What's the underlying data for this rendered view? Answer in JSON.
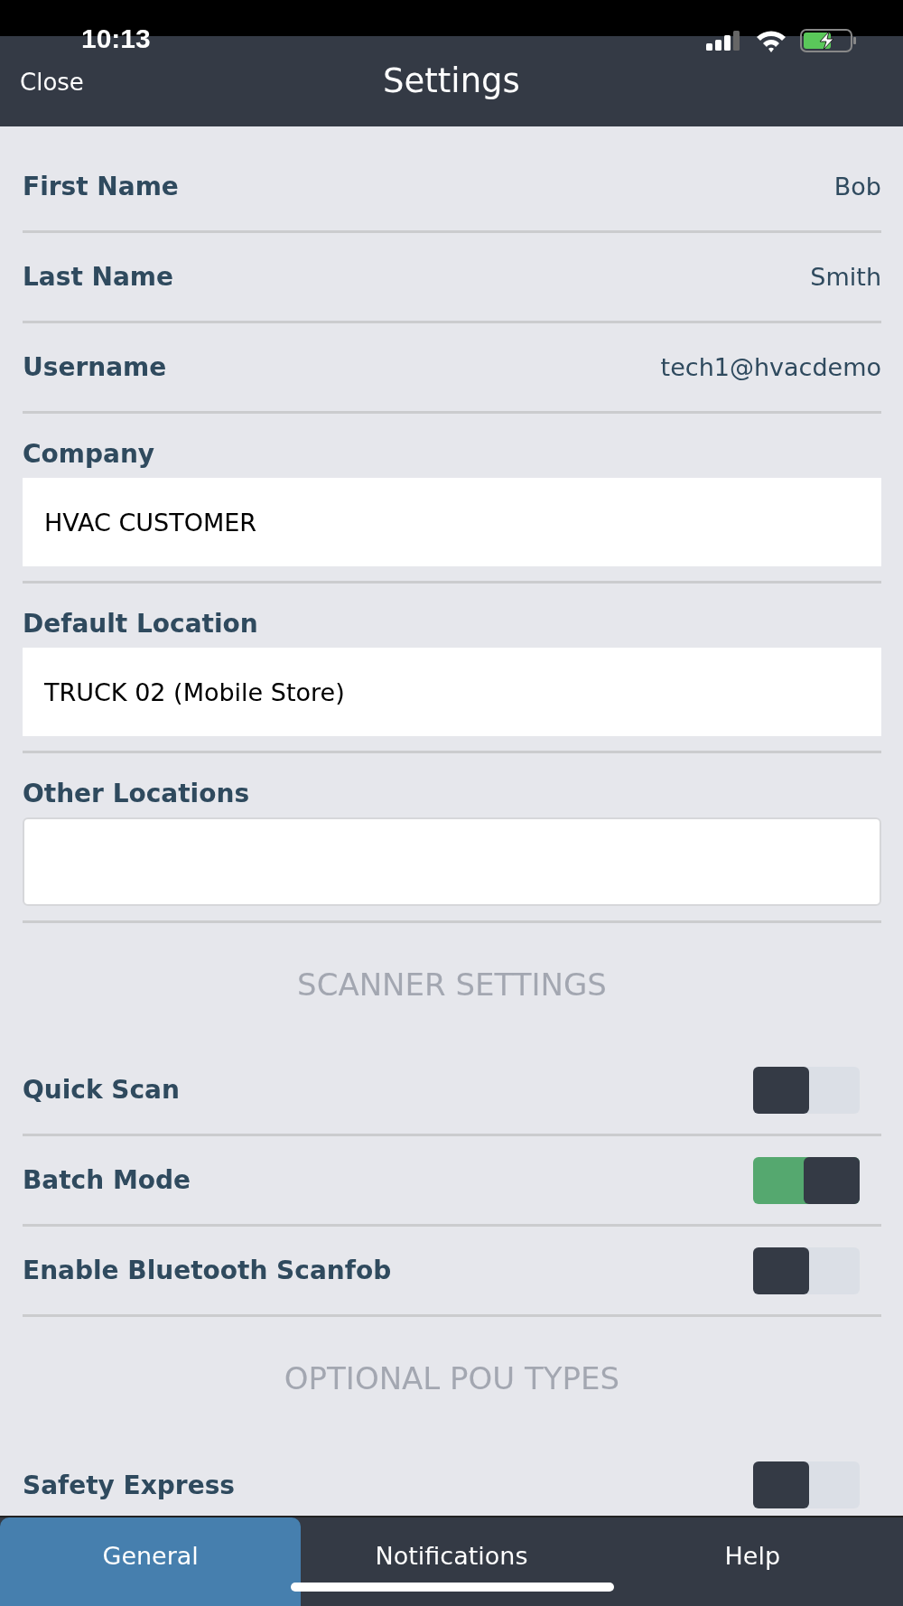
{
  "status_bar": {
    "time": "10:13"
  },
  "nav_bar": {
    "close": "Close",
    "title": "Settings"
  },
  "rows": [
    {
      "kind": "text",
      "label": "First Name",
      "value": "Bob"
    },
    {
      "kind": "text",
      "label": "Last Name",
      "value": "Smith"
    },
    {
      "kind": "text",
      "label": "Username",
      "value": "tech1@hvacdemo"
    },
    {
      "kind": "field",
      "label": "Company",
      "value": "HVAC CUSTOMER"
    },
    {
      "kind": "field",
      "label": "Default Location",
      "value": "TRUCK 02 (Mobile Store)"
    },
    {
      "kind": "box",
      "label": "Other Locations"
    },
    {
      "kind": "header",
      "label": "SCANNER SETTINGS"
    },
    {
      "kind": "toggle",
      "label": "Quick Scan",
      "on": false
    },
    {
      "kind": "toggle",
      "label": "Batch Mode",
      "on": true
    },
    {
      "kind": "toggle",
      "label": "Enable Bluetooth Scanfob",
      "on": false
    },
    {
      "kind": "header",
      "label": "OPTIONAL POU TYPES"
    },
    {
      "kind": "toggle",
      "label": "Safety Express",
      "on": false
    }
  ],
  "tabs": [
    {
      "label": "General",
      "selected": true
    },
    {
      "label": "Notifications",
      "selected": false
    },
    {
      "label": "Help",
      "selected": false
    }
  ]
}
